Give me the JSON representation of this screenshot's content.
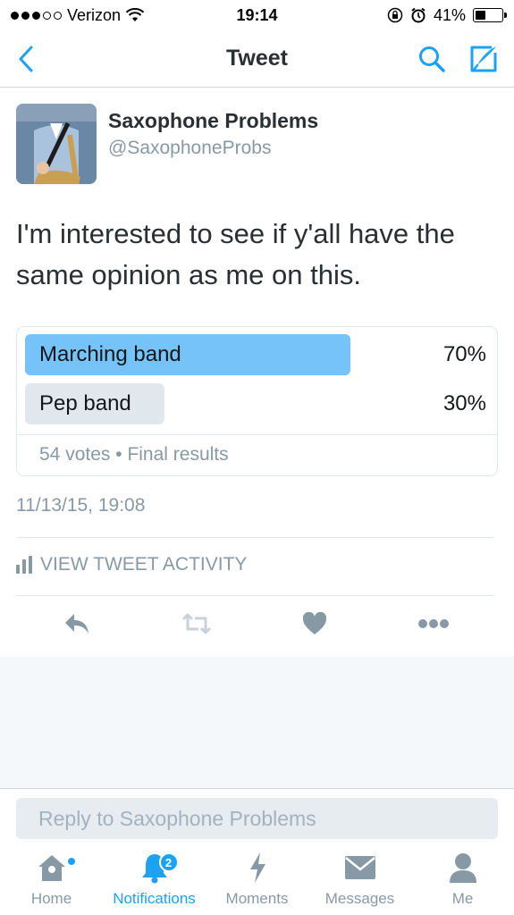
{
  "status_bar": {
    "carrier": "Verizon",
    "time": "19:14",
    "battery": "41%",
    "battery_level": 0.41,
    "signal_bars": 3
  },
  "nav": {
    "title": "Tweet",
    "icons": [
      "back-chevron-icon",
      "search-icon",
      "compose-icon"
    ]
  },
  "tweet": {
    "author_name": "Saxophone Problems",
    "author_handle": "@SaxophoneProbs",
    "text": "I'm interested to see if y'all have the same opinion as me on this.",
    "timestamp": "11/13/15, 19:08",
    "poll": {
      "options": [
        {
          "label": "Marching band",
          "percent": "70%",
          "value": 0.7,
          "winner": true
        },
        {
          "label": "Pep band",
          "percent": "30%",
          "value": 0.3,
          "winner": false
        }
      ],
      "votes": "54 votes",
      "separator": "•",
      "status": "Final results"
    },
    "activity_label": "VIEW TWEET ACTIVITY"
  },
  "reply": {
    "placeholder": "Reply to Saxophone Problems"
  },
  "tabs": [
    {
      "label": "Home",
      "icon": "home-icon",
      "active": false,
      "dot": true
    },
    {
      "label": "Notifications",
      "icon": "bell-icon",
      "active": true,
      "badge": "2"
    },
    {
      "label": "Moments",
      "icon": "lightning-icon",
      "active": false
    },
    {
      "label": "Messages",
      "icon": "envelope-icon",
      "active": false
    },
    {
      "label": "Me",
      "icon": "person-icon",
      "active": false
    }
  ],
  "colors": {
    "accent": "#1da1f2",
    "poll_winner": "#75c3f8",
    "poll_other": "#e1e8ed",
    "muted": "#8899a6"
  }
}
